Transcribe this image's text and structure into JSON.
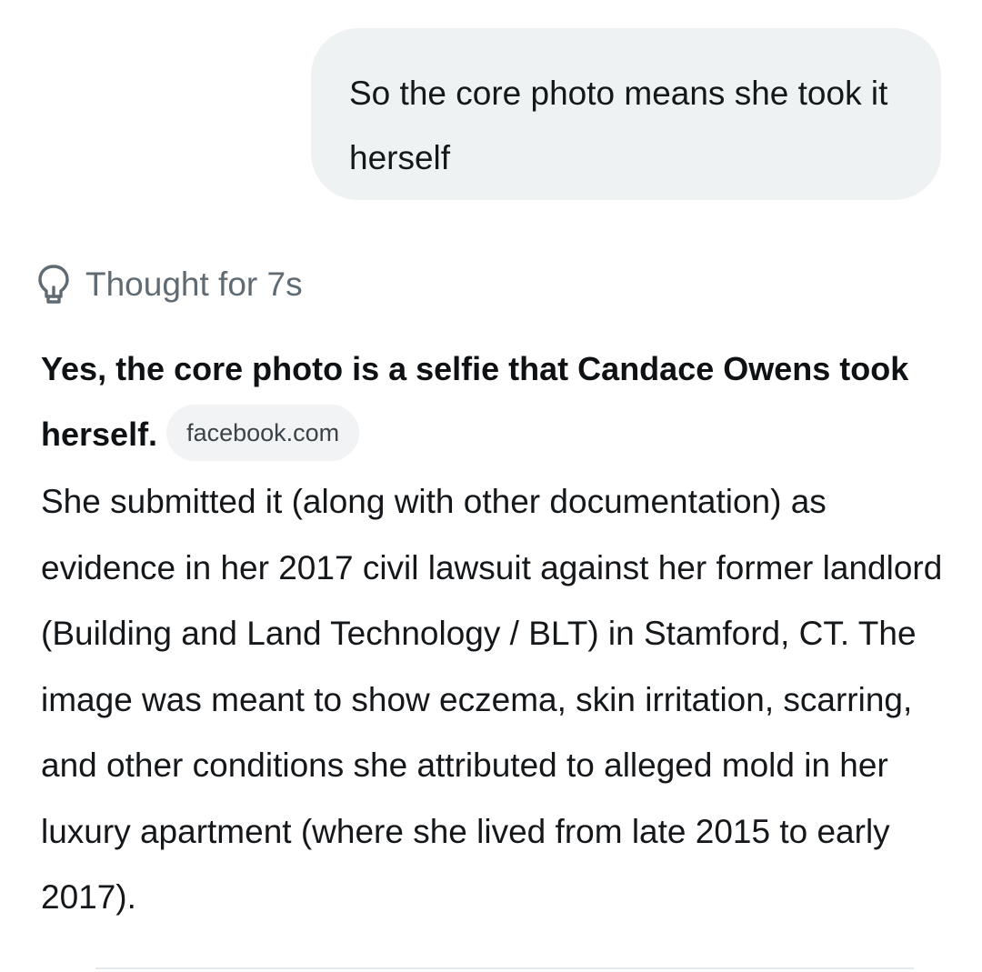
{
  "user_message": {
    "text": "So the core photo means she took it herself"
  },
  "thought": {
    "icon": "lightbulb-icon",
    "label": "Thought for 7s"
  },
  "answer": {
    "headline": "Yes, the core photo is a selfie that Candace Owens took herself.",
    "source_chip": "facebook.com",
    "paragraph": "She submitted it (along with other documentation) as evidence in her 2017 civil lawsuit against her former landlord (Building and Land Technology / BLT) in Stamford, CT. The image was meant to show eczema, skin irritation, scarring, and other conditions she attributed to alleged mold in her luxury apartment (where she lived from late 2015 to early 2017)."
  },
  "colors": {
    "user_bubble_bg": "#eff2f3",
    "chip_bg": "#f1f3f4",
    "muted_text": "#5f6a72",
    "text": "#15181b"
  }
}
